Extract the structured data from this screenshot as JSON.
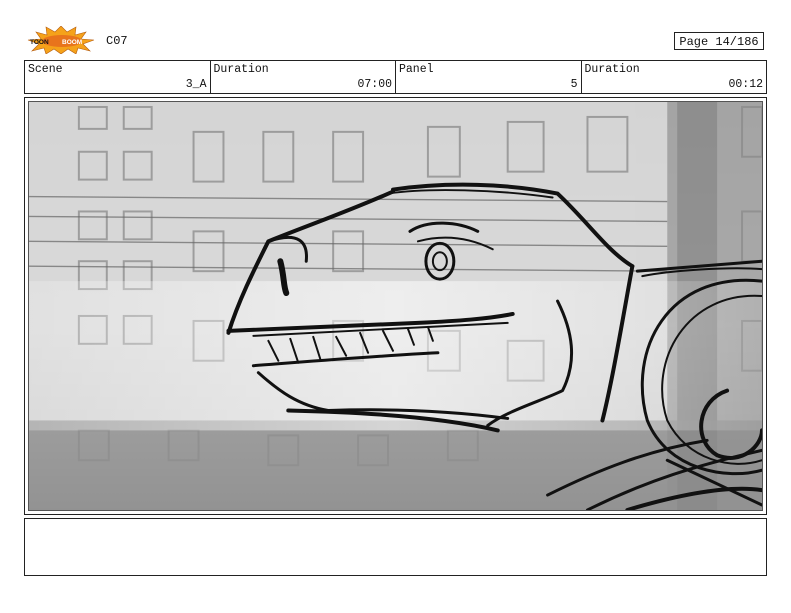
{
  "header": {
    "logo_text_left": "TOON",
    "logo_text_right": "BOOM",
    "production_code": "C07",
    "page_label": "Page",
    "page_value": "14/186"
  },
  "info": {
    "scene_label": "Scene",
    "scene_value": "3_A",
    "scene_duration_label": "Duration",
    "scene_duration_value": "07:00",
    "panel_label": "Panel",
    "panel_value": "5",
    "panel_duration_label": "Duration",
    "panel_duration_value": "00:12"
  },
  "panel": {
    "subject": "dinosaur-sketch"
  },
  "notes": {
    "text": ""
  },
  "colors": {
    "logo_burst": "#f5a21a",
    "logo_center": "#e8741c",
    "ink": "#111111"
  }
}
